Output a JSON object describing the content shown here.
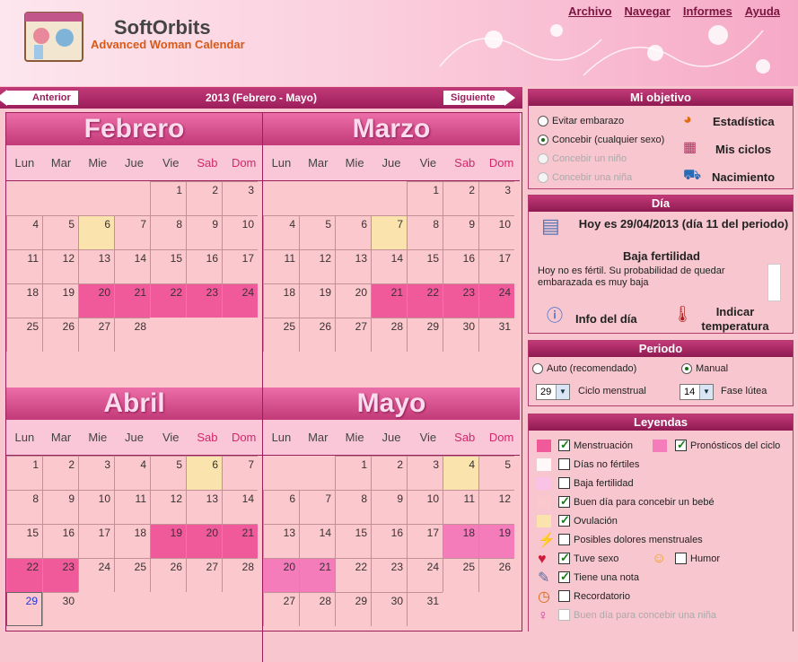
{
  "header": {
    "brand": "SoftOrbits",
    "product": "Advanced Woman Calendar"
  },
  "menu": [
    "Archivo",
    "Navegar",
    "Informes",
    "Ayuda"
  ],
  "nav": {
    "prev": "Anterior",
    "next": "Siguiente",
    "range": "2013 (Febrero - Mayo)"
  },
  "weekdays": [
    "Lun",
    "Mar",
    "Mie",
    "Jue",
    "Vie",
    "Sab",
    "Dom"
  ],
  "months": [
    {
      "name": "Febrero",
      "start": 4,
      "days": 28,
      "ov": [
        6
      ],
      "men": [
        20,
        21,
        22,
        23,
        24
      ],
      "pro": [],
      "today": null
    },
    {
      "name": "Marzo",
      "start": 4,
      "days": 31,
      "ov": [
        7
      ],
      "men": [
        21,
        22,
        23,
        24
      ],
      "pro": [],
      "today": null
    },
    {
      "name": "Abril",
      "start": 0,
      "days": 30,
      "ov": [
        6
      ],
      "men": [
        19,
        20,
        21,
        22,
        23
      ],
      "pro": [],
      "today": 29
    },
    {
      "name": "Mayo",
      "start": 2,
      "days": 31,
      "ov": [
        4
      ],
      "men": [],
      "pro": [
        18,
        19,
        20,
        21
      ],
      "today": null
    }
  ],
  "objetivo": {
    "title": "Mi objetivo",
    "options": [
      "Evitar embarazo",
      "Concebir (cualquier sexo)",
      "Concebir un niño",
      "Concebir una niña"
    ],
    "selected": 1,
    "links": [
      "Estadística",
      "Mis ciclos",
      "Nacimiento"
    ]
  },
  "dia": {
    "title": "Día",
    "today": "Hoy es 29/04/2013 (día 11 del periodo)",
    "status": "Baja fertilidad",
    "desc": "Hoy no es fértil. Su probabilidad de quedar embarazada es muy baja",
    "info": "Info del día",
    "temp": "Indicar temperatura"
  },
  "periodo": {
    "title": "Periodo",
    "auto": "Auto (recomendado)",
    "manual": "Manual",
    "cycle_value": "29",
    "cycle_label": "Ciclo menstrual",
    "luteal_value": "14",
    "luteal_label": "Fase lútea"
  },
  "leyendas": {
    "title": "Leyendas",
    "items": [
      {
        "label": "Menstruación",
        "checked": true
      },
      {
        "label": "Días no fértiles",
        "checked": false
      },
      {
        "label": "Baja fertilidad",
        "checked": false
      },
      {
        "label": "Buen día para concebir un bebé",
        "checked": true
      },
      {
        "label": "Ovulación",
        "checked": true
      },
      {
        "label": "Posibles dolores menstruales",
        "checked": false
      },
      {
        "label": "Tuve sexo",
        "checked": true
      },
      {
        "label": "Tiene una nota",
        "checked": true
      },
      {
        "label": "Recordatorio",
        "checked": false
      },
      {
        "label": "Buen día para concebir una niña",
        "checked": false
      }
    ],
    "pron": "Pronósticos del ciclo",
    "humor": "Humor"
  },
  "colors": {
    "menstruation": "#f0599a",
    "forecast": "#f47cbb",
    "ovulation": "#fbe3ad",
    "low": "#f9c2e6",
    "good": "#fbc8cd",
    "nonfertile": "#fff8f8"
  }
}
